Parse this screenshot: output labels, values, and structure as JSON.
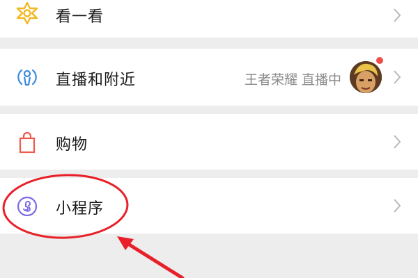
{
  "menu": {
    "items": [
      {
        "label": "看一看",
        "icon": "star-icon"
      },
      {
        "label": "直播和附近",
        "icon": "location-broadcast-icon",
        "status_text": "王者荣耀 直播中",
        "has_avatar": true,
        "has_notification_dot": true
      },
      {
        "label": "购物",
        "icon": "shopping-bag-icon"
      },
      {
        "label": "小程序",
        "icon": "mini-program-icon"
      }
    ]
  },
  "colors": {
    "page_bg": "#ededed",
    "row_bg": "#ffffff",
    "star_icon": "#f3b81e",
    "location_icon": "#3a8be0",
    "bag_icon": "#f05a4a",
    "mini_program_icon": "#7a6be6",
    "annotation_red": "#e8202a",
    "notification_dot": "#f04d4d"
  }
}
